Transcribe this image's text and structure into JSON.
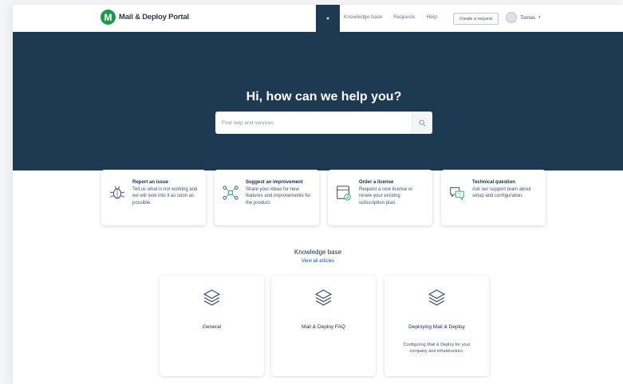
{
  "topbar": {
    "brand_initial": "M",
    "brand_name": "Mail & Deploy Portal",
    "nav_links": [
      "Knowledge base",
      "Requests",
      "Help"
    ],
    "nav_button": "Create a request",
    "user_name": "Tomas"
  },
  "hero": {
    "title": "Hi, how can we help you?",
    "search_placeholder": "Find help and services"
  },
  "request_cards": [
    {
      "title": "Report an issue",
      "text": "Tell us what is not working and we will look into it as soon as possible."
    },
    {
      "title": "Suggest an improvement",
      "text": "Share your ideas for new features and improvements for the product."
    },
    {
      "title": "Order a license",
      "text": "Request a new license or renew your existing subscription plan."
    },
    {
      "title": "Technical question",
      "text": "Ask our support team about setup and configuration."
    }
  ],
  "knowledge_base": {
    "title": "Knowledge base",
    "link": "View all articles",
    "cards": [
      {
        "name": "General",
        "desc": ""
      },
      {
        "name": "Mail & Deploy FAQ",
        "desc": ""
      },
      {
        "name": "Deploying Mail & Deploy",
        "desc": "Configuring Mail & Deploy for your company and infrastructure."
      }
    ]
  },
  "colors": {
    "hero_bg": "#1e3a52",
    "brand_green": "#1f9a4a",
    "link_blue": "#0052cc"
  }
}
